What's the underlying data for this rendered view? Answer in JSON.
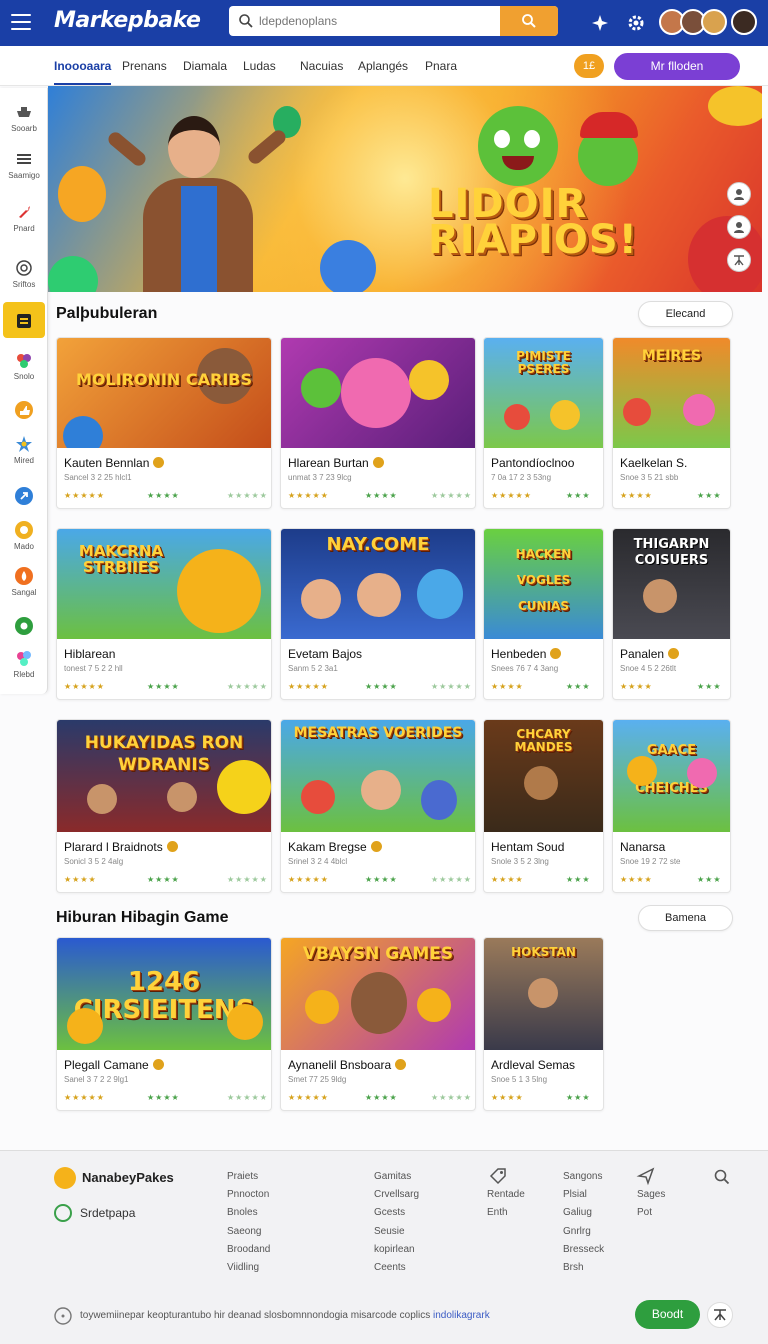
{
  "app": {
    "logo": "Markepbake",
    "search_placeholder": "ldepdenoplans"
  },
  "nav": {
    "tabs": [
      "Inoooaara",
      "Prenans",
      "Diamala",
      "Ludas",
      "Nacuias",
      "Aplangés",
      "Pnara"
    ],
    "coin_label": "1£",
    "cta_label": "Mr flloden"
  },
  "sidebar": {
    "items": [
      {
        "label": "Sooarb",
        "icon": "game-icon"
      },
      {
        "label": "Saamigo",
        "icon": "list-icon"
      },
      {
        "label": "Pnard",
        "icon": "rocket-icon"
      },
      {
        "label": "Sriftos",
        "icon": "target-icon"
      },
      {
        "label": "",
        "icon": "tile-icon"
      },
      {
        "label": "Snolo",
        "icon": "balls-icon"
      },
      {
        "label": "",
        "icon": "thumb-icon"
      },
      {
        "label": "Mired",
        "icon": "star-icon"
      },
      {
        "label": "",
        "icon": "arrow-icon"
      },
      {
        "label": "Mado",
        "icon": "coin-icon"
      },
      {
        "label": "Sangal",
        "icon": "fire-icon"
      },
      {
        "label": "",
        "icon": "chat-icon"
      },
      {
        "label": "Rlebd",
        "icon": "balloons-icon"
      }
    ]
  },
  "hero": {
    "title": "LIDOIR RIAPIOS!"
  },
  "section1": {
    "title": "Palþubuleran",
    "button": "Elecand",
    "cards": [
      {
        "banner": "MOLIRONIN CARIBS",
        "title": "Kauten Bennlan",
        "sub": "Sancel 3 2 25 hlcl1",
        "verified": true
      },
      {
        "banner": "",
        "title": "Hlarean Burtan",
        "sub": "unmat 3 7 23 9lcg",
        "verified": true
      },
      {
        "banner": "PIMISTE PSERES",
        "title": "Pantondíoclnoo",
        "sub": "7 0a 17 2 3 53ng",
        "verified": false
      },
      {
        "banner": "MEIRES",
        "title": "Kaelkelan S.",
        "sub": "Snoe 3 5 21 sbb",
        "verified": false
      },
      {
        "banner": "MAKCRNA STRBIIES",
        "title": "Hiblarean",
        "sub": "tonest 7 5 2 2 hll",
        "verified": false
      },
      {
        "banner": "NAY.COME",
        "title": "Evetam Bajos",
        "sub": "Sanm 5 2 3a1",
        "verified": false
      },
      {
        "banner": "HACKEN VOGLES CUNIAS",
        "title": "Henbeden",
        "sub": "Snees 76 7 4 3ang",
        "verified": true
      },
      {
        "banner": "THIGARPN COISUERS",
        "title": "Panalen",
        "sub": "Snoe 4 5 2 26tlt",
        "verified": true
      },
      {
        "banner": "HUKAYIDAS RON WDRANIS",
        "title": "Plarard l Braidnots",
        "sub": "Sonicl 3 5 2 4alg",
        "verified": true
      },
      {
        "banner": "MESATRAS VOERIDES",
        "title": "Kakam Bregse",
        "sub": "Srinel 3 2 4 4blcl",
        "verified": true
      },
      {
        "banner": "CHCARY MANDES",
        "title": "Hentam Soud",
        "sub": "Snole 3 5 2 3lng",
        "verified": false
      },
      {
        "banner": "GAACE CHEICHES",
        "title": "Nanarsa",
        "sub": "Snoe 19 2 72 ste",
        "verified": false
      }
    ]
  },
  "section2": {
    "title": "Hiburan Hibagin Game",
    "button": "Bamena",
    "cards": [
      {
        "banner": "1246 CIRSIEITENS",
        "title": "Plegall Camane",
        "sub": "Sanel 3 7 2 2 9lg1",
        "verified": true
      },
      {
        "banner": "VBAYSN GAMES",
        "title": "Aynanelil Bnsboara",
        "sub": "Smet 77 25 9ldg",
        "verified": true
      },
      {
        "banner": "HOKSTAN",
        "title": "Ardleval Semas",
        "sub": "Snoe 5 1 3 5lng",
        "verified": false
      }
    ]
  },
  "footer": {
    "brand": "NanabeyPakes",
    "radio_label": "Srdetpapa",
    "col1": [
      "Praiets",
      "Pnnocton",
      "Bnoles",
      "Saeong",
      "Broodand",
      "Viidling"
    ],
    "col2": [
      "Gamitas",
      "Crvellsarg",
      "Gcests",
      "Seusie",
      "kopirlean",
      "Ceents"
    ],
    "col3": [
      "Rentade",
      "Enth"
    ],
    "col4": [
      "Sangons",
      "Plsial",
      "Galiug",
      "Gnrlrg",
      "Bresseck",
      "Brsh"
    ],
    "col5": [
      "Sages",
      "Pot"
    ],
    "bottom_text": "toywemiinepar keopturantubo hir deanad slosbomnnondogia misarcode coplics",
    "bottom_link": "indolikagrark",
    "button": "Boodt"
  },
  "colors": {
    "topbar": "#1a3fa6",
    "accent_orange": "#f0a030",
    "cta_purple": "#7b3fd4",
    "footer_green": "#2e9e3e"
  }
}
